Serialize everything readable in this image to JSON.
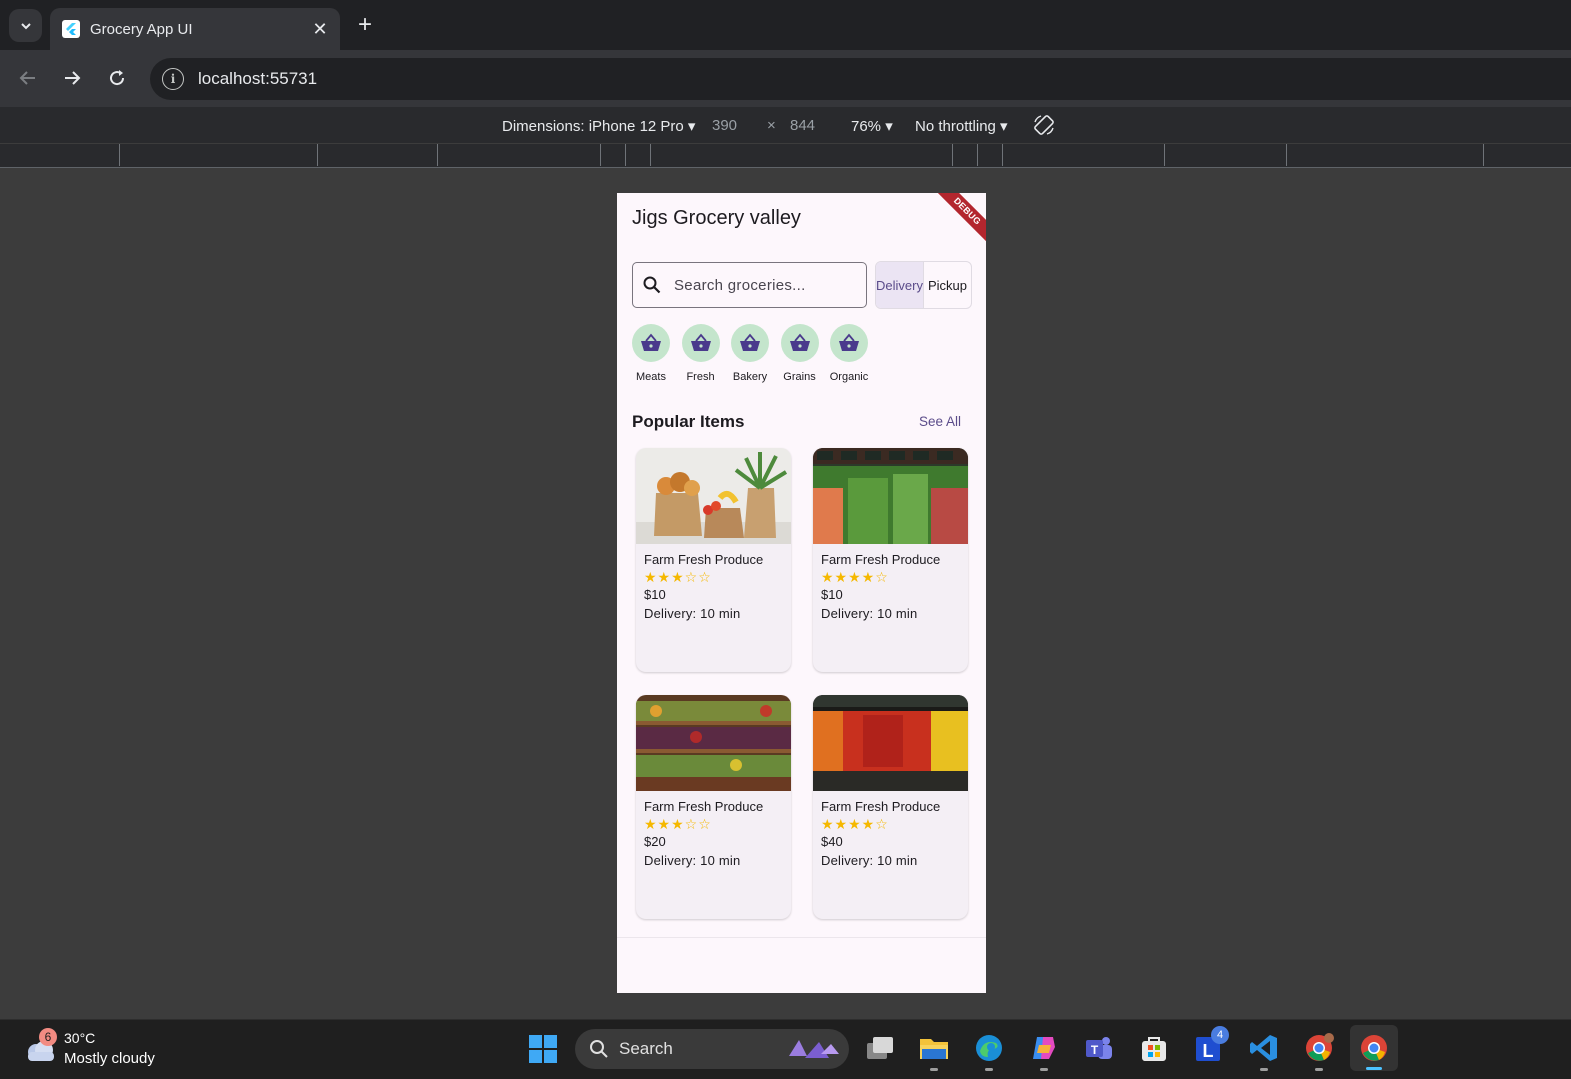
{
  "browser": {
    "tab_title": "Grocery App UI",
    "url": "localhost:55731",
    "close_glyph": "✕",
    "new_tab_glyph": "+"
  },
  "devtools": {
    "dimensions_label": "Dimensions: iPhone 12 Pro",
    "width": "390",
    "times": "×",
    "height": "844",
    "zoom": "76%",
    "throttling": "No throttling"
  },
  "app": {
    "debug_label": "DEBUG",
    "title": "Jigs Grocery valley",
    "search_placeholder": "Search groceries...",
    "mode_options": [
      "Delivery",
      "Pickup"
    ],
    "selected_mode": "Delivery",
    "categories": [
      {
        "label": "Meats",
        "icon": "basket-icon"
      },
      {
        "label": "Fresh",
        "icon": "basket-icon"
      },
      {
        "label": "Bakery",
        "icon": "basket-icon"
      },
      {
        "label": "Grains",
        "icon": "basket-icon"
      },
      {
        "label": "Organic",
        "icon": "basket-icon"
      }
    ],
    "section_title": "Popular Items",
    "see_all": "See All",
    "products": [
      {
        "name": "Farm Fresh Produce",
        "rating": 3,
        "stars": "★★★☆☆",
        "price": "$10",
        "delivery": "Delivery: 10 min",
        "image": "grocery-bags-photo"
      },
      {
        "name": "Farm Fresh Produce",
        "rating": 4,
        "stars": "★★★★☆",
        "price": "$10",
        "delivery": "Delivery: 10 min",
        "image": "vegetable-shelf-photo"
      },
      {
        "name": "Farm Fresh Produce",
        "rating": 3,
        "stars": "★★★☆☆",
        "price": "$20",
        "delivery": "Delivery: 10 min",
        "image": "produce-rack-photo"
      },
      {
        "name": "Farm Fresh Produce",
        "rating": 4,
        "stars": "★★★★☆",
        "price": "$40",
        "delivery": "Delivery: 10 min",
        "image": "peppers-display-photo"
      }
    ]
  },
  "taskbar": {
    "weather_badge": "6",
    "temperature": "30°C",
    "condition": "Mostly cloudy",
    "search_label": "Search",
    "store_badge": "4"
  },
  "colors": {
    "accent": "#5b4c8a",
    "category_bg": "#c4e5cc",
    "star": "#f5b800",
    "debug": "#b3262e"
  }
}
